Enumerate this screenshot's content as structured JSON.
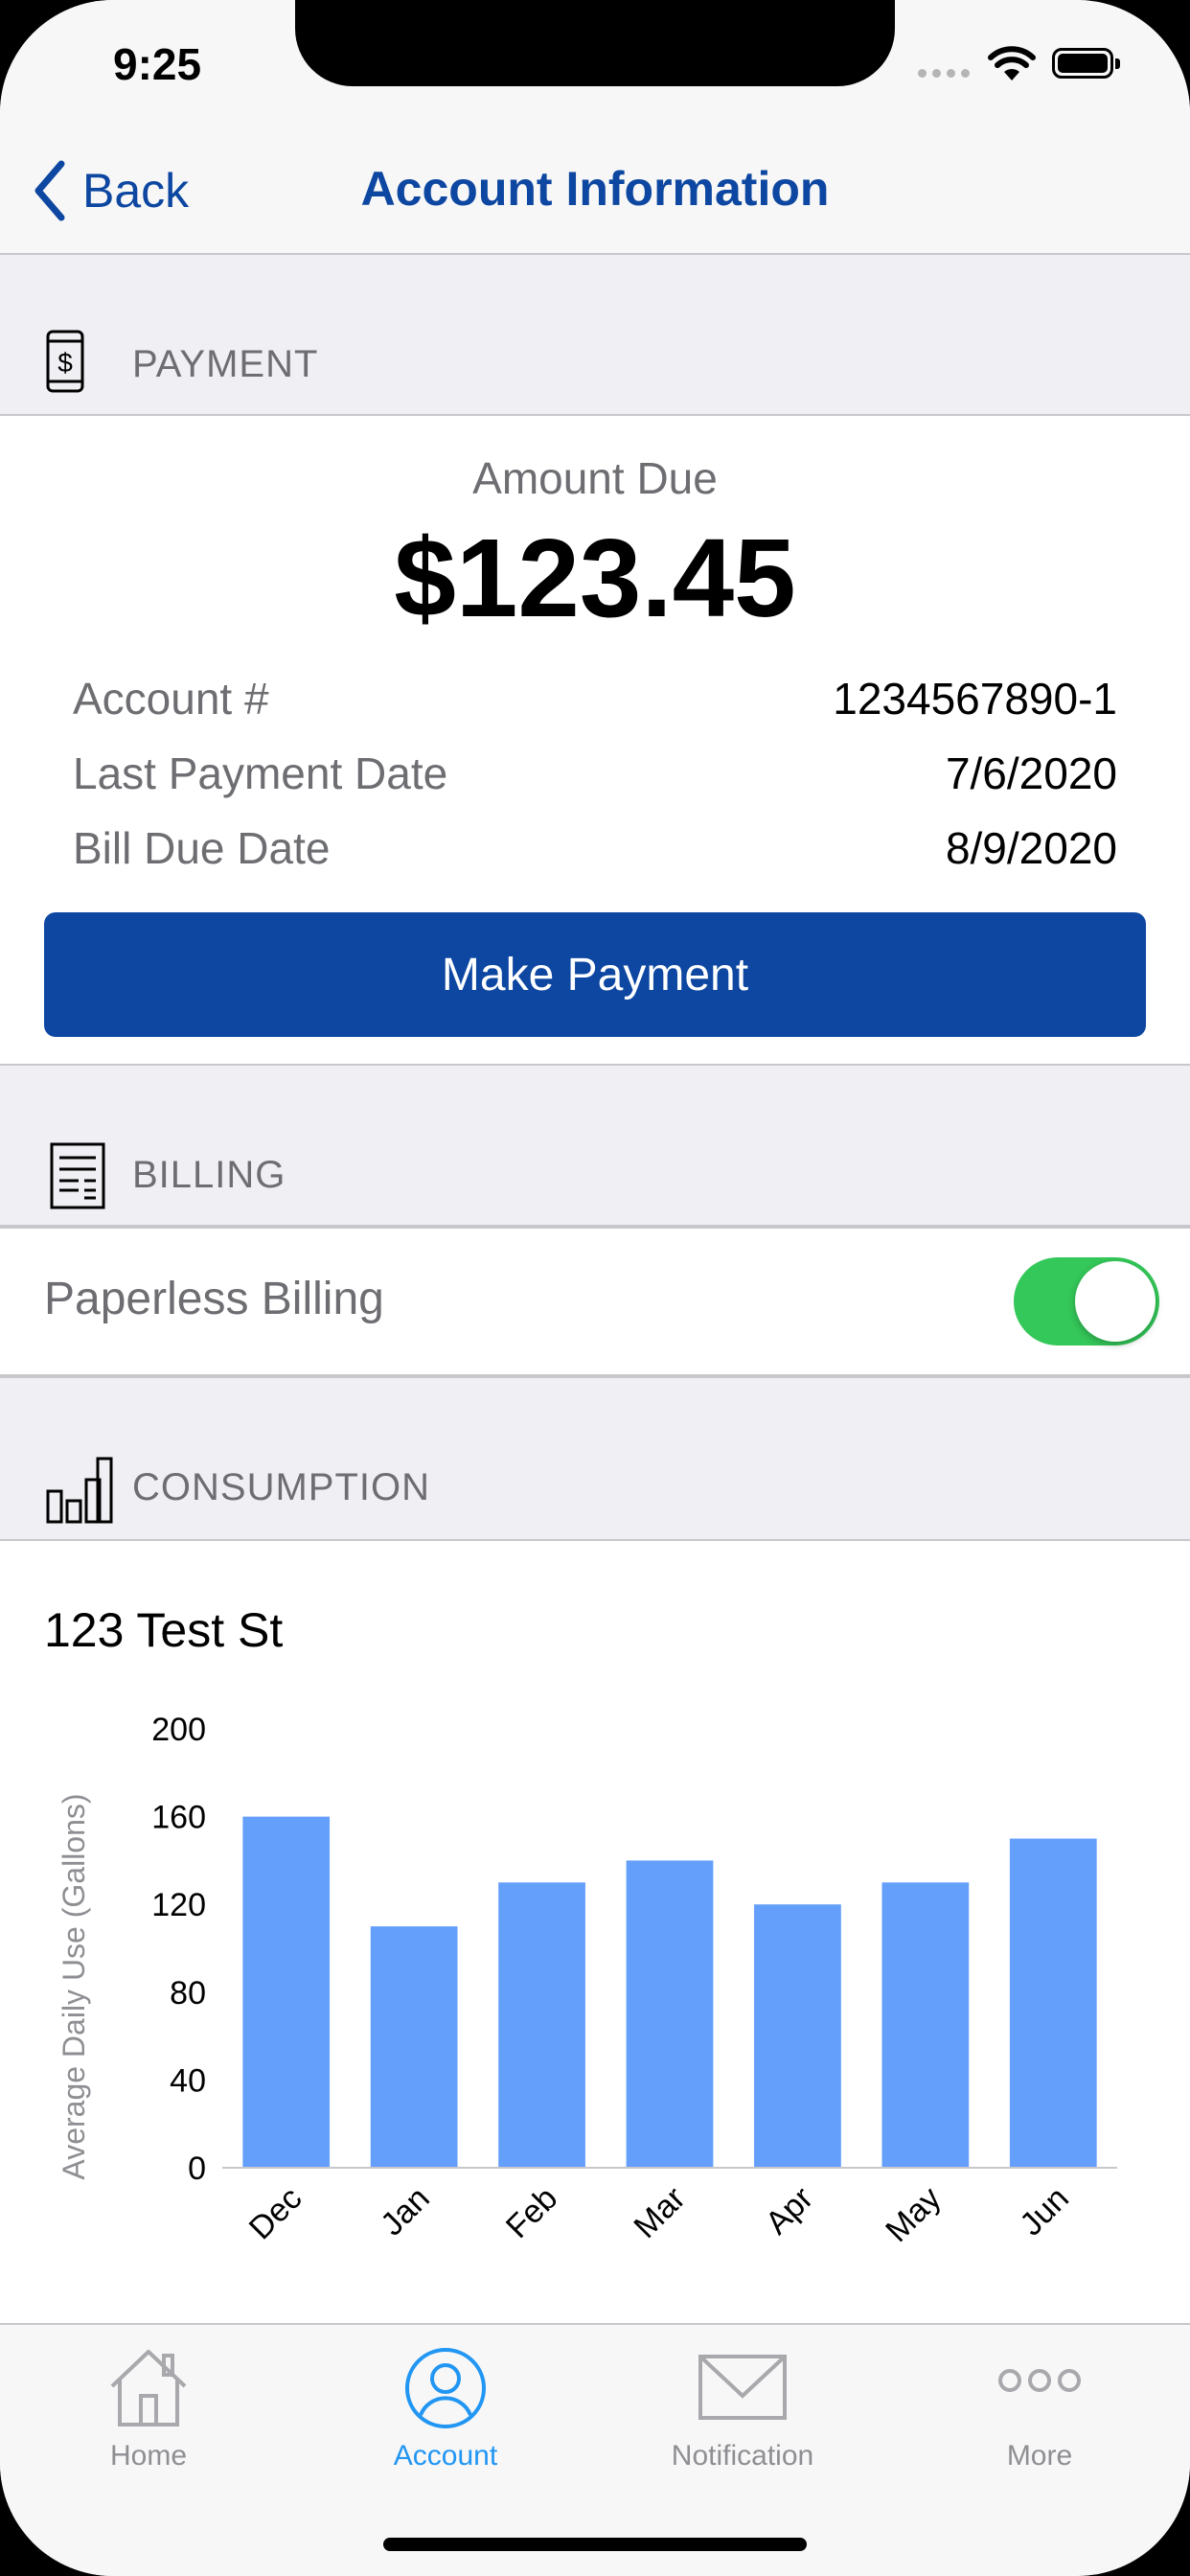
{
  "status_bar": {
    "time": "9:25"
  },
  "nav": {
    "back_label": "Back",
    "title": "Account Information"
  },
  "payment": {
    "section_label": "PAYMENT",
    "amount_due_label": "Amount Due",
    "amount_due": "$123.45",
    "rows": [
      {
        "label": "Account #",
        "value": "1234567890-1"
      },
      {
        "label": "Last Payment Date",
        "value": "7/6/2020"
      },
      {
        "label": "Bill Due Date",
        "value": "8/9/2020"
      }
    ],
    "button_label": "Make Payment"
  },
  "billing": {
    "section_label": "BILLING",
    "paperless_label": "Paperless Billing",
    "paperless_enabled": true
  },
  "consumption": {
    "section_label": "CONSUMPTION",
    "address": "123 Test St"
  },
  "chart_data": {
    "type": "bar",
    "categories": [
      "Dec",
      "Jan",
      "Feb",
      "Mar",
      "Apr",
      "May",
      "Jun"
    ],
    "values": [
      160,
      110,
      130,
      140,
      120,
      130,
      150
    ],
    "ylabel": "Average Daily Use (Gallons)",
    "xlabel": "",
    "ylim": [
      0,
      200
    ],
    "yticks": [
      0,
      40,
      80,
      120,
      160,
      200
    ],
    "bar_color": "#659ffc",
    "grid": false
  },
  "tabbar": {
    "items": [
      {
        "label": "Home",
        "icon": "home-icon",
        "active": false
      },
      {
        "label": "Account",
        "icon": "account-icon",
        "active": true
      },
      {
        "label": "Notification",
        "icon": "envelope-icon",
        "active": false
      },
      {
        "label": "More",
        "icon": "more-icon",
        "active": false
      }
    ]
  },
  "colors": {
    "brand_blue": "#0d47a1",
    "active_tab": "#2196f3",
    "toggle_on": "#34c759",
    "bar": "#659ffc"
  }
}
